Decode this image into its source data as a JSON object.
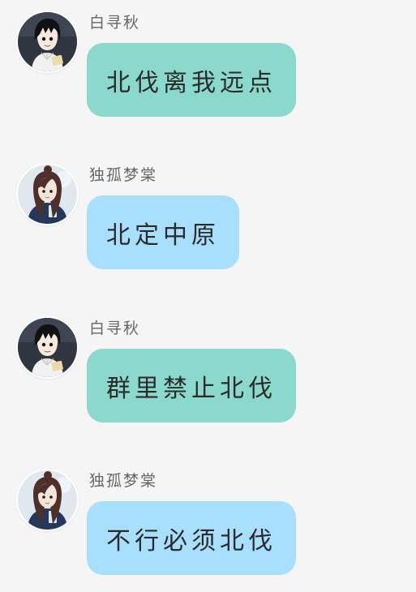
{
  "theme": {
    "background": "#f5f5f5",
    "bubble_teal": "#8ad9cc",
    "bubble_blue": "#a7dffd",
    "sender_text": "#666666",
    "bubble_text": "#2b2b2b"
  },
  "messages": [
    {
      "sender": "白寻秋",
      "avatar": "boy-avatar",
      "text": "北伐离我远点",
      "bubble_color": "teal"
    },
    {
      "sender": "独孤梦棠",
      "avatar": "girl-avatar",
      "text": "北定中原",
      "bubble_color": "blue"
    },
    {
      "sender": "白寻秋",
      "avatar": "boy-avatar",
      "text": "群里禁止北伐",
      "bubble_color": "teal"
    },
    {
      "sender": "独孤梦棠",
      "avatar": "girl-avatar",
      "text": "不行必须北伐",
      "bubble_color": "blue"
    }
  ]
}
